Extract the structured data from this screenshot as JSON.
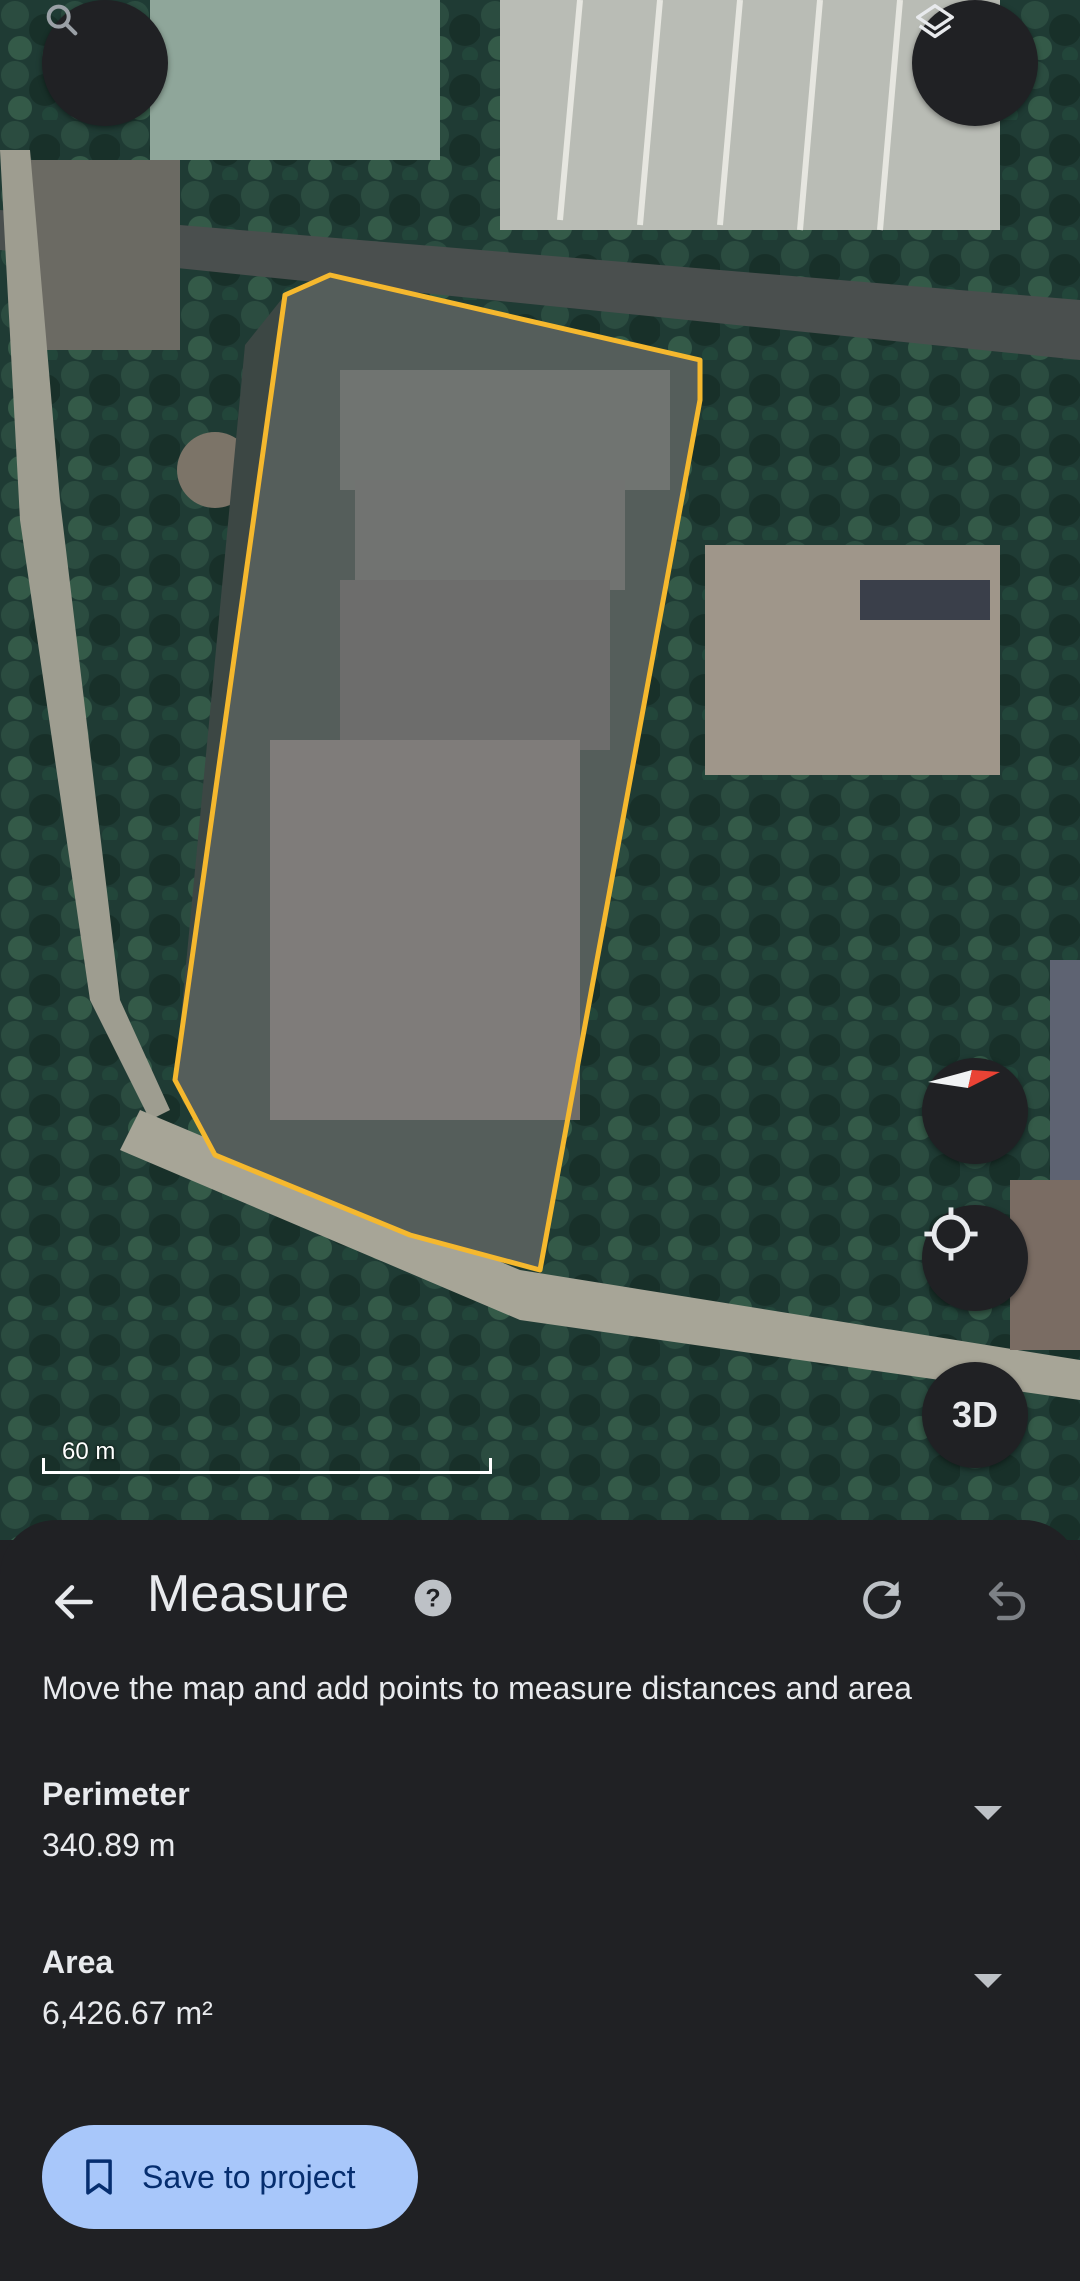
{
  "map": {
    "scale_label": "60 m",
    "measure_line_color": "#f5b82e",
    "buttons": {
      "search_icon": "search-icon",
      "layers_icon": "layers-icon",
      "compass_icon": "compass-icon",
      "locate_icon": "my-location-icon",
      "three_d_label": "3D"
    }
  },
  "sheet": {
    "title": "Measure",
    "back_icon": "arrow-back-icon",
    "help_icon": "help-icon",
    "redo_icon": "redo-icon",
    "undo_icon": "undo-icon",
    "description": "Move the map and add points to measure distances and area",
    "perimeter": {
      "label": "Perimeter",
      "value": "340.89 m"
    },
    "area": {
      "label": "Area",
      "value": "6,426.67 m²"
    },
    "save_button": {
      "label": "Save to project",
      "icon": "bookmark-icon"
    }
  },
  "colors": {
    "sheet_bg": "#202124",
    "button_bg": "#a8c7fa",
    "button_text": "#062e6f",
    "text": "#e8eaed"
  }
}
